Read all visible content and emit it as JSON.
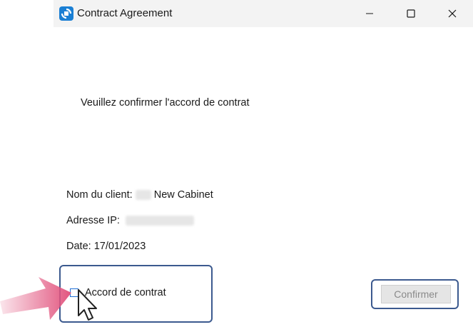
{
  "window": {
    "title": "Contract Agreement",
    "accent": "#1a7fd4"
  },
  "titlebar": {
    "buttons": [
      "minimize-icon",
      "maximize-icon",
      "close-icon"
    ]
  },
  "content": {
    "prompt": "Veuillez confirmer l'accord de contrat",
    "client_label": "Nom du client:",
    "client_value": "New Cabinet",
    "ip_label": "Adresse IP:",
    "date_label": "Date:",
    "date_value": "17/01/2023"
  },
  "agreement": {
    "checkbox_label": "Accord de contrat",
    "checked": false
  },
  "actions": {
    "confirm_label": "Confirmer",
    "confirm_enabled": false
  },
  "overlay": {
    "pointer_arrow_color": "#e2557f",
    "highlight_color": "#3c5a8f"
  }
}
